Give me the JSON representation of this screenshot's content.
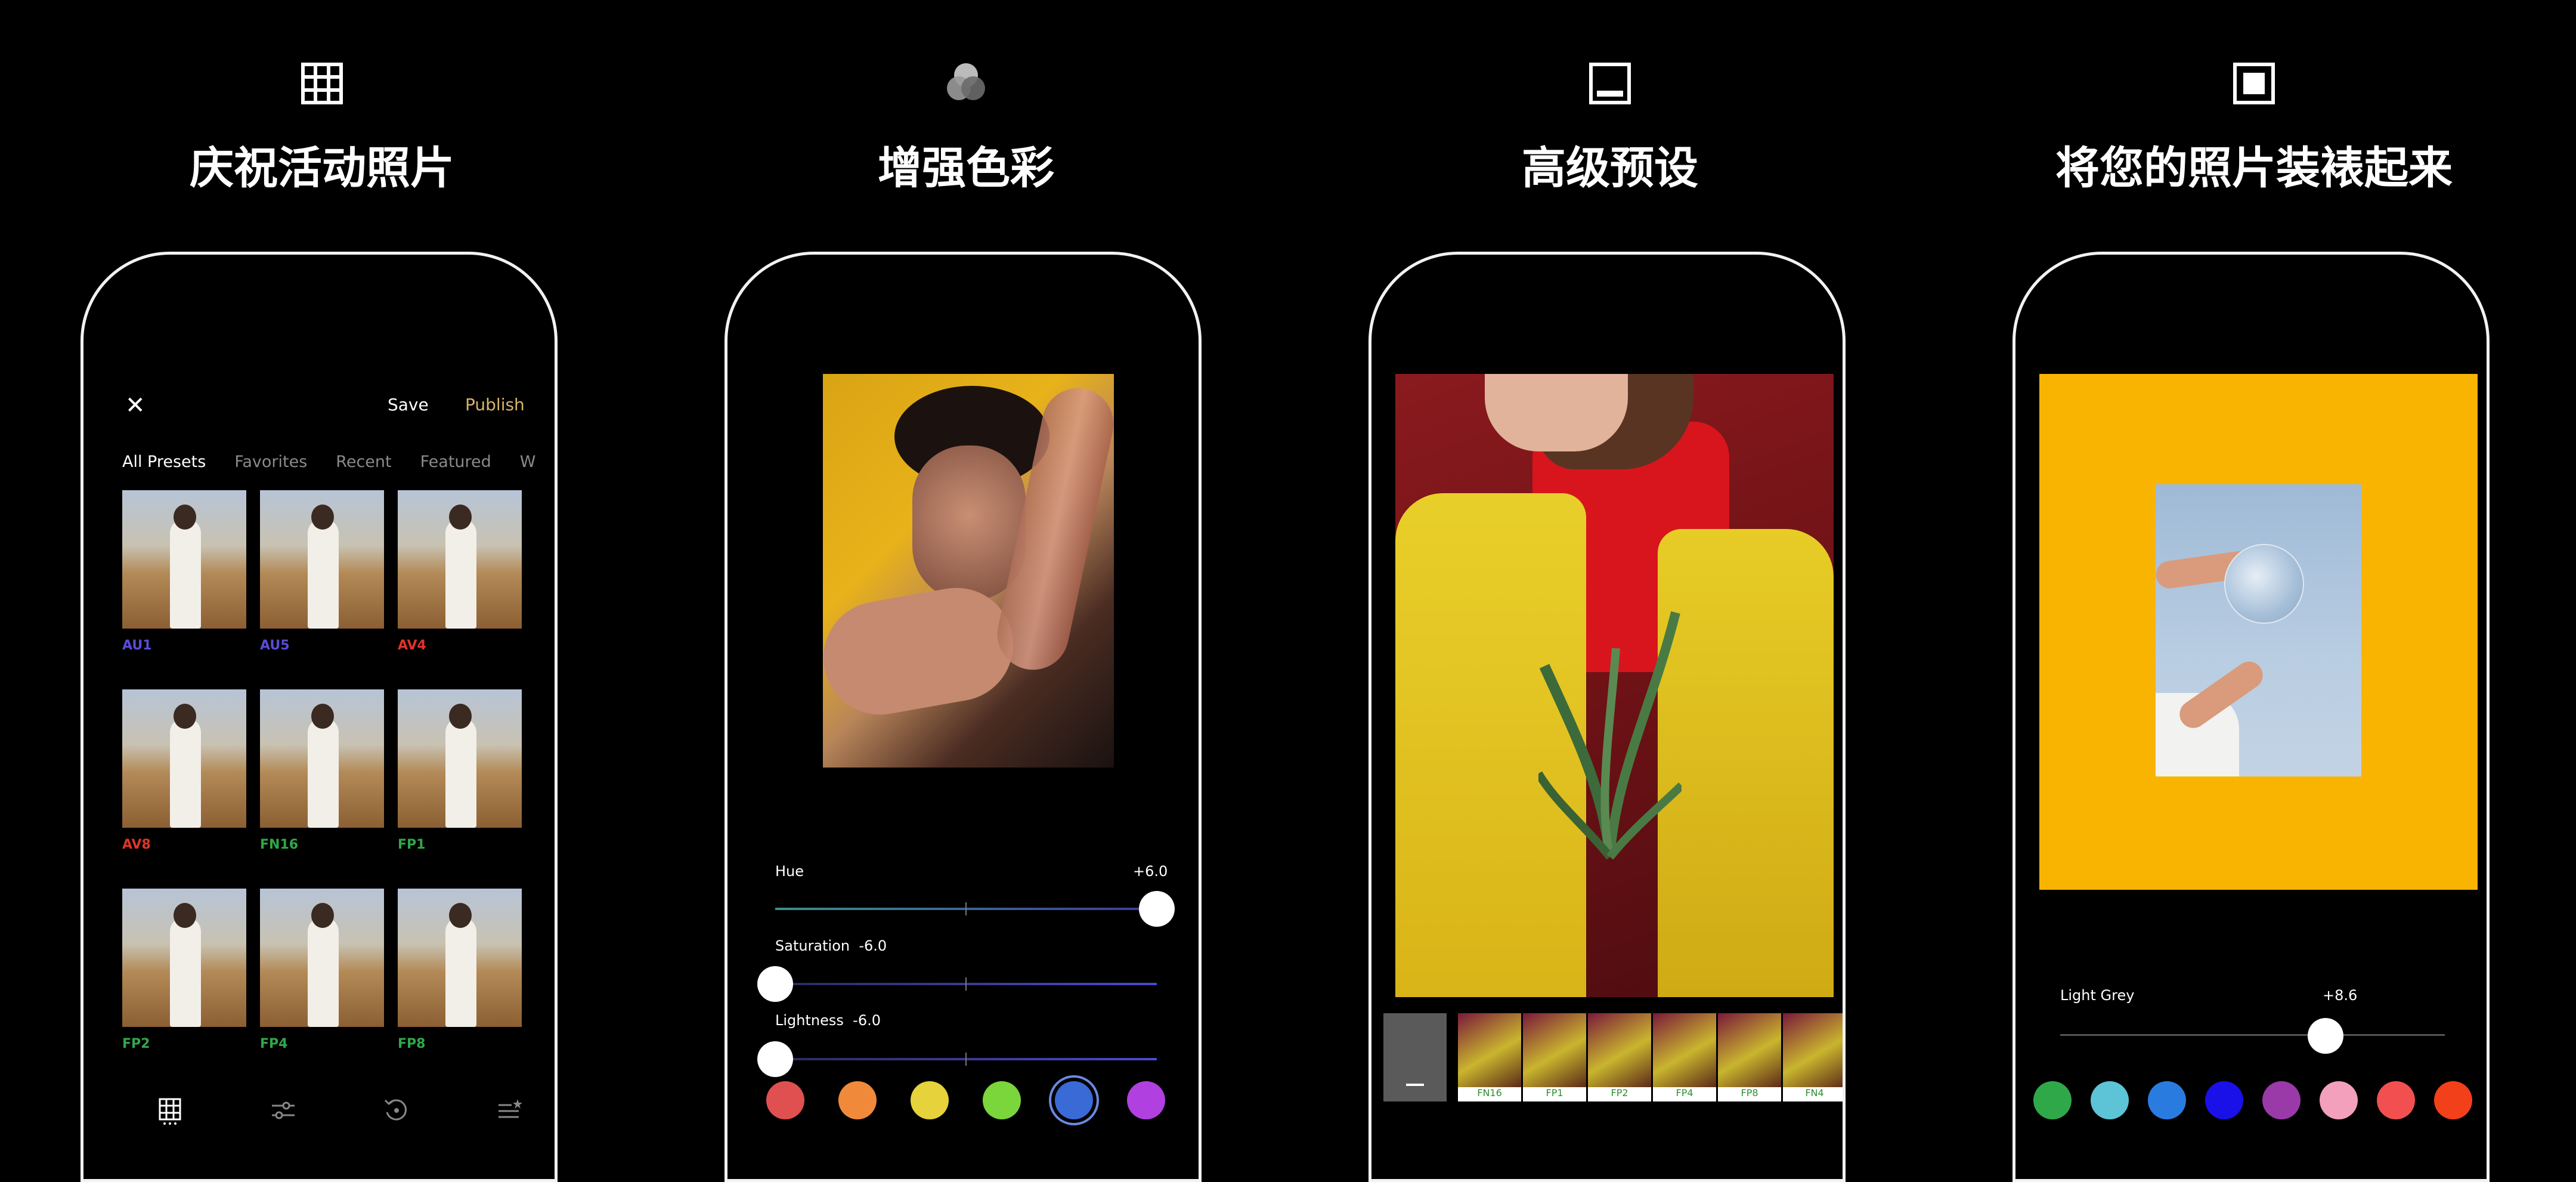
{
  "panels": [
    {
      "title": "庆祝活动照片",
      "icon": "grid-icon"
    },
    {
      "title": "增强色彩",
      "icon": "color-circles-icon"
    },
    {
      "title": "高级预设",
      "icon": "preset-frame-icon"
    },
    {
      "title": "将您的照片装裱起来",
      "icon": "frame-icon"
    }
  ],
  "screen1": {
    "close_label": "✕",
    "save_label": "Save",
    "publish_label": "Publish",
    "tabs": [
      "All Presets",
      "Favorites",
      "Recent",
      "Featured",
      "W"
    ],
    "presets": [
      {
        "name": "AU1",
        "color": "#5a4cd6"
      },
      {
        "name": "AU5",
        "color": "#5a4cd6"
      },
      {
        "name": "AV4",
        "color": "#e0342a"
      },
      {
        "name": "AV8",
        "color": "#e0342a"
      },
      {
        "name": "FN16",
        "color": "#2fa84a"
      },
      {
        "name": "FP1",
        "color": "#2fa84a"
      },
      {
        "name": "FP2",
        "color": "#2fa84a"
      },
      {
        "name": "FP4",
        "color": "#2fa84a"
      },
      {
        "name": "FP8",
        "color": "#2fa84a"
      }
    ],
    "nav_icons": [
      "grid-icon",
      "sliders-icon",
      "history-icon",
      "starred-list-icon"
    ]
  },
  "screen2": {
    "hue": {
      "label": "Hue",
      "value_text": "+6.0",
      "value": 6.0
    },
    "saturation": {
      "label": "Saturation",
      "value_text": "-6.0",
      "value": -6.0
    },
    "lightness": {
      "label": "Lightness",
      "value_text": "-6.0",
      "value": -6.0
    },
    "swatches": [
      "#e05050",
      "#f08a3a",
      "#e6d23a",
      "#7ad63a",
      "#3a6ad6",
      "#b040e0"
    ],
    "selected_swatch": 4
  },
  "screen3": {
    "filters": [
      "FN16",
      "FP1",
      "FP2",
      "FP4",
      "FP8",
      "FN4"
    ]
  },
  "screen4": {
    "frame_color": "#f8b400",
    "adjust": {
      "label": "Light Grey",
      "value_text": "+8.6",
      "value": 8.6
    },
    "swatches": [
      "#2fa84a",
      "#5cc4d6",
      "#2a7be0",
      "#1a10e8",
      "#9a3aa8",
      "#f2a0bc",
      "#f25050",
      "#f2401a"
    ]
  }
}
